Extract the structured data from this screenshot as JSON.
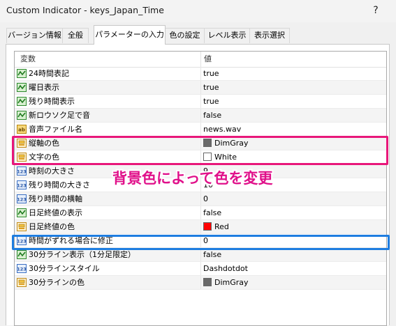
{
  "window": {
    "title": "Custom Indicator - keys_Japan_Time",
    "help_label": "?"
  },
  "tabs": [
    {
      "label": "バージョン情報"
    },
    {
      "label": "全般"
    },
    {
      "label": "パラメーターの入力"
    },
    {
      "label": "色の設定"
    },
    {
      "label": "レベル表示"
    },
    {
      "label": "表示選択"
    }
  ],
  "grid": {
    "header": {
      "name": "変数",
      "value": "値"
    },
    "rows": [
      {
        "icon": "bool-icon",
        "name": "24時間表記",
        "value": "true"
      },
      {
        "icon": "bool-icon",
        "name": "曜日表示",
        "value": "true"
      },
      {
        "icon": "bool-icon",
        "name": "残り時間表示",
        "value": "true"
      },
      {
        "icon": "bool-icon",
        "name": "新ロウソク足で音",
        "value": "false"
      },
      {
        "icon": "string-icon",
        "name": "音声ファイル名",
        "value": "news.wav"
      },
      {
        "icon": "color-icon",
        "name": "縦軸の色",
        "value": "DimGray",
        "swatch": "#696969"
      },
      {
        "icon": "color-icon",
        "name": "文字の色",
        "value": "White",
        "swatch": "#ffffff"
      },
      {
        "icon": "int-icon",
        "name": "時刻の大きさ",
        "value": "9"
      },
      {
        "icon": "int-icon",
        "name": "残り時間の大きさ",
        "value": "10"
      },
      {
        "icon": "int-icon",
        "name": "残り時間の横軸",
        "value": "0"
      },
      {
        "icon": "bool-icon",
        "name": "日足終値の表示",
        "value": "false"
      },
      {
        "icon": "color-icon",
        "name": "日足終値の色",
        "value": "Red",
        "swatch": "#ff0000"
      },
      {
        "icon": "int-icon",
        "name": "時間がずれる場合に修正",
        "value": "0"
      },
      {
        "icon": "bool-icon",
        "name": "30分ライン表示（1分足限定）",
        "value": "false"
      },
      {
        "icon": "int-icon",
        "name": "30分ラインスタイル",
        "value": "Dashdotdot"
      },
      {
        "icon": "color-icon",
        "name": "30分ラインの色",
        "value": "DimGray",
        "swatch": "#696969"
      }
    ]
  },
  "annotation": {
    "text": "背景色によって色を変更",
    "color": "#e0108a"
  },
  "highlight_colors": {
    "pink": "#e8177a",
    "blue": "#1e7de0"
  }
}
